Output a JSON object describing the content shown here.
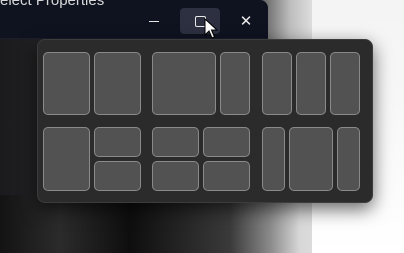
{
  "window": {
    "title": "elect Properties"
  },
  "controls": {
    "minimize": "minimize-icon",
    "maximize": "maximize-icon",
    "close_glyph": "✕"
  },
  "snap_layouts": [
    {
      "name": "two-equal-columns",
      "zones": 2
    },
    {
      "name": "wide-left-narrow-right",
      "zones": 2
    },
    {
      "name": "three-columns",
      "zones": 3
    },
    {
      "name": "left-and-two-stacked-right",
      "zones": 3
    },
    {
      "name": "four-quadrants",
      "zones": 4
    },
    {
      "name": "narrow-wide-narrow",
      "zones": 3
    }
  ],
  "colors": {
    "flyout_bg": "#2b2b2b",
    "zone_fill": "#525252",
    "zone_border": "#8a8a8a",
    "titlebar_bg": "#0f1320"
  }
}
